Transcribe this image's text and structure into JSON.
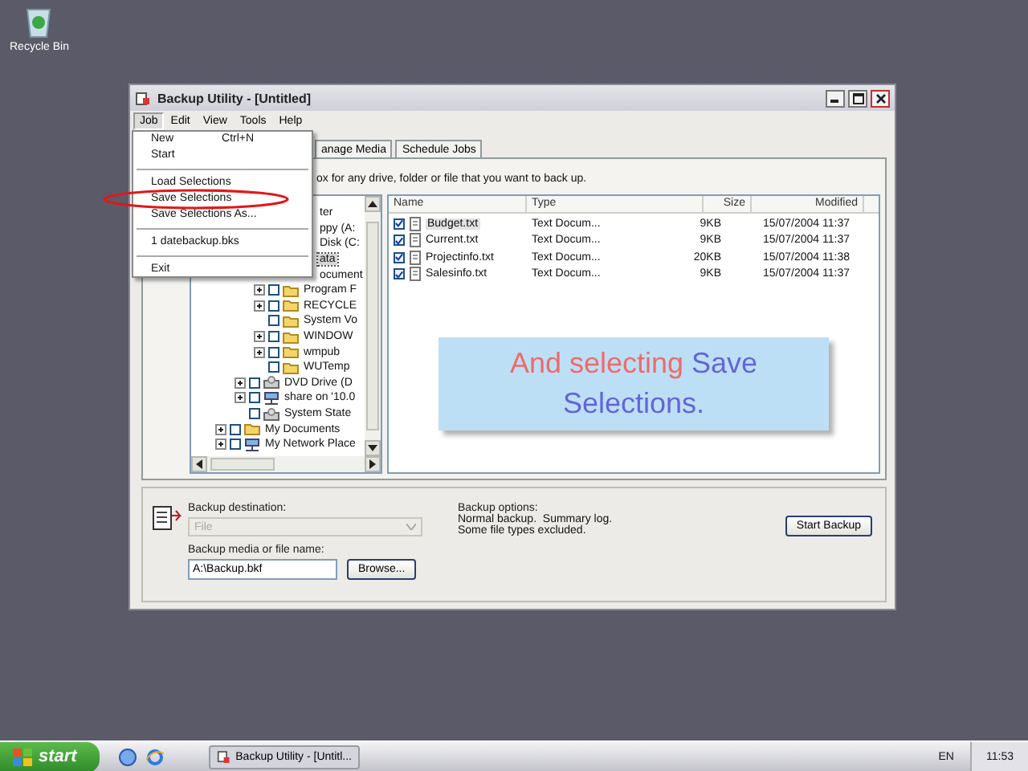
{
  "desktop": {
    "icons": [
      {
        "label": "Recycle Bin"
      }
    ]
  },
  "window": {
    "title": "Backup Utility - [Untitled]"
  },
  "menubar": [
    {
      "label": "Job",
      "selected": true
    },
    {
      "label": "Edit",
      "selected": false
    },
    {
      "label": "View",
      "selected": false
    },
    {
      "label": "Tools",
      "selected": false
    },
    {
      "label": "Help",
      "selected": false
    }
  ],
  "menu": {
    "items": [
      {
        "kind": "item",
        "label": "New",
        "shortcut": "Ctrl+N"
      },
      {
        "kind": "item",
        "label": "Start"
      },
      {
        "kind": "separator"
      },
      {
        "kind": "item",
        "label": "Load Selections"
      },
      {
        "kind": "item",
        "label": "Save Selections"
      },
      {
        "kind": "item",
        "label": "Save Selections As..."
      },
      {
        "kind": "separator"
      },
      {
        "kind": "item",
        "label": "1 datebackup.bks"
      },
      {
        "kind": "separator"
      },
      {
        "kind": "item",
        "label": "Exit"
      }
    ]
  },
  "tabs": [
    {
      "label": "anage Media",
      "selected": false
    },
    {
      "label": "Schedule Jobs",
      "selected": false
    }
  ],
  "instruction": "ox for any drive, folder or file that you want to back up.",
  "tree": {
    "items": [
      {
        "label": "ter",
        "covered": true,
        "selected": false,
        "children": [
          {
            "label": "ppy (A:",
            "covered": true,
            "selected": false
          },
          {
            "label": "Disk (C:",
            "covered": true,
            "selected": false,
            "children": [
              {
                "label": "ata",
                "covered": true,
                "selected": true
              },
              {
                "label": "ocument",
                "covered": true,
                "selected": false
              },
              {
                "label": "Program F",
                "kind": "folder",
                "expander": true,
                "checked": false,
                "selected": false
              },
              {
                "label": "RECYCLE",
                "kind": "folder",
                "expander": true,
                "checked": false,
                "selected": false
              },
              {
                "label": "System Vo",
                "kind": "folder",
                "expander": false,
                "checked": false,
                "selected": false
              },
              {
                "label": "WINDOW",
                "kind": "folder",
                "expander": true,
                "checked": false,
                "selected": false
              },
              {
                "label": "wmpub",
                "kind": "folder",
                "expander": true,
                "checked": false,
                "selected": false
              },
              {
                "label": "WUTemp",
                "kind": "folder",
                "expander": false,
                "checked": false,
                "selected": false
              }
            ]
          },
          {
            "label": "DVD Drive (D",
            "kind": "drive",
            "expander": true,
            "checked": false,
            "selected": false
          },
          {
            "label": "share on '10.0",
            "kind": "network",
            "expander": true,
            "checked": false,
            "selected": false
          },
          {
            "label": "System State",
            "kind": "drive",
            "expander": false,
            "checked": false,
            "selected": false
          }
        ]
      },
      {
        "label": "My Documents",
        "kind": "folder",
        "expander": true,
        "checked": false,
        "selected": false
      },
      {
        "label": "My Network Place",
        "kind": "network",
        "expander": true,
        "checked": false,
        "selected": false
      }
    ]
  },
  "file_list": {
    "columns": [
      "Name",
      "Type",
      "Size",
      "Modified"
    ],
    "rows": [
      {
        "checked": true,
        "selected": true,
        "name": "Budget.txt",
        "type": "Text Docum...",
        "size": "9KB",
        "modified": "15/07/2004 11:37"
      },
      {
        "checked": true,
        "selected": false,
        "name": "Current.txt",
        "type": "Text Docum...",
        "size": "9KB",
        "modified": "15/07/2004 11:37"
      },
      {
        "checked": true,
        "selected": false,
        "name": "Projectinfo.txt",
        "type": "Text Docum...",
        "size": "20KB",
        "modified": "15/07/2004 11:38"
      },
      {
        "checked": true,
        "selected": false,
        "name": "Salesinfo.txt",
        "type": "Text Docum...",
        "size": "9KB",
        "modified": "15/07/2004 11:37"
      }
    ]
  },
  "callout": {
    "parts": [
      {
        "text": "And selecting",
        "color": "#f06a6a"
      },
      {
        "text": "Save Selections.",
        "color": "#6464d8"
      }
    ]
  },
  "backup": {
    "destination_label": "Backup destination:",
    "destination_value": "File",
    "destination_disabled": true,
    "media_label": "Backup media or file name:",
    "media_value": "A:\\Backup.bkf",
    "browse_button": "Browse...",
    "options_label": "Backup options:",
    "options_lines": [
      "Normal backup.  Summary log.",
      "Some file types excluded."
    ],
    "start_button": "Start Backup"
  },
  "taskbar": {
    "start": "start",
    "tasks": [
      {
        "label": "Backup Utility - [Untitl...",
        "selected": false
      }
    ],
    "language": "EN",
    "clock": "11:53"
  }
}
